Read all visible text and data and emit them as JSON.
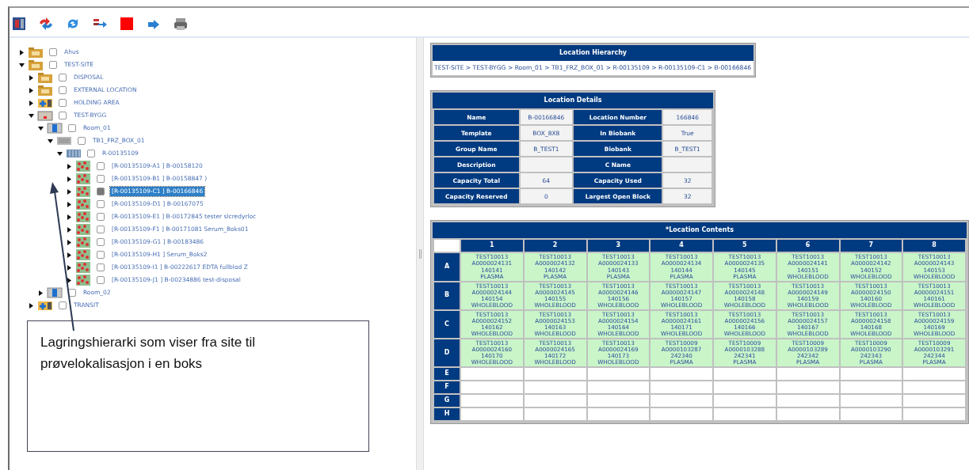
{
  "toolbar": {
    "buttons": [
      {
        "kind": "panel"
      },
      {
        "kind": "swap"
      },
      {
        "kind": "refresh"
      },
      {
        "kind": "move"
      },
      {
        "kind": "stop"
      },
      {
        "kind": "arrow"
      },
      {
        "kind": "print"
      }
    ]
  },
  "tree": [
    {
      "label": "Ahus",
      "kind": "folder",
      "expanded": false,
      "checked": false,
      "selected": false
    },
    {
      "label": "TEST-SITE",
      "kind": "folder",
      "expanded": true,
      "checked": false,
      "selected": false,
      "children": [
        {
          "label": "DISPOSAL",
          "kind": "folder",
          "expanded": false,
          "checked": false,
          "selected": false
        },
        {
          "label": "EXTERNAL LOCATION",
          "kind": "folder",
          "expanded": false,
          "checked": false,
          "selected": false
        },
        {
          "label": "HOLDING AREA",
          "kind": "holding",
          "expanded": false,
          "checked": false,
          "selected": false
        },
        {
          "label": "TEST-BYGG",
          "kind": "building",
          "expanded": true,
          "checked": false,
          "selected": false,
          "children": [
            {
              "label": "Room_01",
              "kind": "room",
              "expanded": true,
              "checked": false,
              "selected": false,
              "children": [
                {
                  "label": "TB1_FRZ_BOX_01",
                  "kind": "freezer",
                  "expanded": true,
                  "checked": false,
                  "selected": false,
                  "children": [
                    {
                      "label": "R-00135109",
                      "kind": "rack",
                      "expanded": true,
                      "checked": false,
                      "selected": false,
                      "children": [
                        {
                          "label": "[R-00135109-A1 ] B-00158120",
                          "kind": "box",
                          "expanded": false,
                          "checked": false,
                          "selected": false
                        },
                        {
                          "label": "[R-00135109-B1 ] B-00158847 )",
                          "kind": "box",
                          "expanded": false,
                          "checked": false,
                          "selected": false
                        },
                        {
                          "label": "[R-00135109-C1 ] B-00166846",
                          "kind": "box",
                          "expanded": false,
                          "checked": true,
                          "selected": true
                        },
                        {
                          "label": "[R-00135109-D1 ] B-00167075",
                          "kind": "box",
                          "expanded": false,
                          "checked": false,
                          "selected": false
                        },
                        {
                          "label": "[R-00135109-E1 ] B-00172845 tester slcredyrloc",
                          "kind": "box",
                          "expanded": false,
                          "checked": false,
                          "selected": false
                        },
                        {
                          "label": "[R-00135109-F1 ] B-00171081 Serum_Boks01",
                          "kind": "box",
                          "expanded": false,
                          "checked": false,
                          "selected": false
                        },
                        {
                          "label": "[R-00135109-G1 ] B-00183486",
                          "kind": "box",
                          "expanded": false,
                          "checked": false,
                          "selected": false
                        },
                        {
                          "label": "[R-00135109-H1 ] Serum_Boks2",
                          "kind": "box",
                          "expanded": false,
                          "checked": false,
                          "selected": false
                        },
                        {
                          "label": "[R-00135109-I1 ] B-00222617 EDTA fullblod Z",
                          "kind": "box",
                          "expanded": false,
                          "checked": false,
                          "selected": false
                        },
                        {
                          "label": "[R-00135109-J1 ] B-00234886 test-disposal",
                          "kind": "box",
                          "expanded": false,
                          "checked": false,
                          "selected": false
                        }
                      ]
                    }
                  ]
                }
              ]
            },
            {
              "label": "Room_02",
              "kind": "room",
              "expanded": false,
              "checked": false,
              "selected": false
            }
          ]
        },
        {
          "label": "TRANSIT",
          "kind": "holding",
          "expanded": false,
          "checked": false,
          "selected": false
        }
      ]
    }
  ],
  "callout": {
    "text": "Lagringshierarki som viser fra site til prøvelokalisasjon i en boks"
  },
  "hierarchy": {
    "title": "Location Hierarchy",
    "path": "TEST-SITE > TEST-BYGG > Room_01 > TB1_FRZ_BOX_01 > R-00135109 > R-00135109-C1 > B-00166846"
  },
  "details": {
    "title": "Location Details",
    "rows": [
      {
        "label_1": "Name",
        "value_1": "B-00166846",
        "label_2": "Location Number",
        "value_2": "166846"
      },
      {
        "label_1": "Template",
        "value_1": "BOX_8X8",
        "label_2": "In Biobank",
        "value_2": "True"
      },
      {
        "label_1": "Group Name",
        "value_1": "B_TEST1",
        "label_2": "Biobank",
        "value_2": "B_TEST1"
      },
      {
        "label_1": "Description",
        "label_2": "C Name"
      },
      {
        "label_1": "Capacity Total",
        "value_1": "64",
        "label_2": "Capacity Used",
        "value_2": "32"
      },
      {
        "label_1": "Capacity Reserved",
        "value_1": "0",
        "label_2": "Largest Open Block",
        "value_2": "32"
      }
    ]
  },
  "contents": {
    "title": "*Location Contents",
    "columns": [
      "1",
      "2",
      "3",
      "4",
      "5",
      "6",
      "7",
      "8"
    ],
    "rows": [
      {
        "label": "A",
        "cells": [
          [
            "TEST10013",
            "A0000024131",
            "140141",
            "PLASMA"
          ],
          [
            "TEST10013",
            "A0000024132",
            "140142",
            "PLASMA"
          ],
          [
            "TEST10013",
            "A0000024133",
            "140143",
            "PLASMA"
          ],
          [
            "TEST10013",
            "A0000024134",
            "140144",
            "PLASMA"
          ],
          [
            "TEST10013",
            "A0000024135",
            "140145",
            "PLASMA"
          ],
          [
            "TEST10013",
            "A0000024141",
            "140151",
            "WHOLEBLOOD"
          ],
          [
            "TEST10013",
            "A0000024142",
            "140152",
            "WHOLEBLOOD"
          ],
          [
            "TEST10013",
            "A0000024143",
            "140153",
            "WHOLEBLOOD"
          ]
        ]
      },
      {
        "label": "B",
        "cells": [
          [
            "TEST10013",
            "A0000024144",
            "140154",
            "WHOLEBLOOD"
          ],
          [
            "TEST10013",
            "A0000024145",
            "140155",
            "WHOLEBLOOD"
          ],
          [
            "TEST10013",
            "A0000024146",
            "140156",
            "WHOLEBLOOD"
          ],
          [
            "TEST10013",
            "A0000024147",
            "140157",
            "WHOLEBLOOD"
          ],
          [
            "TEST10013",
            "A0000024148",
            "140158",
            "WHOLEBLOOD"
          ],
          [
            "TEST10013",
            "A0000024149",
            "140159",
            "WHOLEBLOOD"
          ],
          [
            "TEST10013",
            "A0000024150",
            "140160",
            "WHOLEBLOOD"
          ],
          [
            "TEST10013",
            "A0000024151",
            "140161",
            "WHOLEBLOOD"
          ]
        ]
      },
      {
        "label": "C",
        "cells": [
          [
            "TEST10013",
            "A0000024152",
            "140162",
            "WHOLEBLOOD"
          ],
          [
            "TEST10013",
            "A0000024153",
            "140163",
            "WHOLEBLOOD"
          ],
          [
            "TEST10013",
            "A0000024154",
            "140164",
            "WHOLEBLOOD"
          ],
          [
            "TEST10013",
            "A0000024161",
            "140171",
            "WHOLEBLOOD"
          ],
          [
            "TEST10013",
            "A0000024156",
            "140166",
            "WHOLEBLOOD"
          ],
          [
            "TEST10013",
            "A0000024157",
            "140167",
            "WHOLEBLOOD"
          ],
          [
            "TEST10013",
            "A0000024158",
            "140168",
            "WHOLEBLOOD"
          ],
          [
            "TEST10013",
            "A0000024159",
            "140169",
            "WHOLEBLOOD"
          ]
        ]
      },
      {
        "label": "D",
        "cells": [
          [
            "TEST10013",
            "A0000024160",
            "140170",
            "WHOLEBLOOD"
          ],
          [
            "TEST10013",
            "A0000024165",
            "140172",
            "WHOLEBLOOD"
          ],
          [
            "TEST10013",
            "A0000024169",
            "140173",
            "WHOLEBLOOD"
          ],
          [
            "TEST10009",
            "A0000103287",
            "242340",
            "PLASMA"
          ],
          [
            "TEST10009",
            "A0000103288",
            "242341",
            "PLASMA"
          ],
          [
            "TEST10009",
            "A0000103289",
            "242342",
            "PLASMA"
          ],
          [
            "TEST10009",
            "A0000103290",
            "242343",
            "PLASMA"
          ],
          [
            "TEST10009",
            "A0000103291",
            "242344",
            "PLASMA"
          ]
        ]
      },
      {
        "label": "E"
      },
      {
        "label": "F"
      },
      {
        "label": "G"
      },
      {
        "label": "H"
      }
    ]
  }
}
